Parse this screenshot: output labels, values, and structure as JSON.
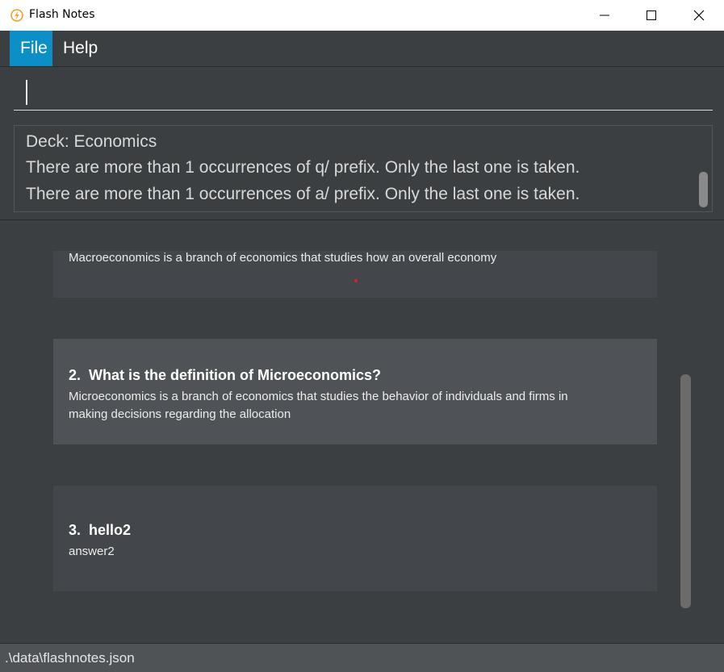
{
  "window": {
    "title": "Flash Notes"
  },
  "menu": {
    "file": "File",
    "help": "Help"
  },
  "command": {
    "value": ""
  },
  "result": {
    "lines": [
      "Deck: Economics",
      "There are more than 1 occurrences of q/ prefix. Only the last one is taken.",
      "There are more than 1 occurrences of a/ prefix. Only the last one is taken."
    ]
  },
  "cards": [
    {
      "answer": "Macroeconomics is a branch of economics that studies how an overall economy"
    },
    {
      "index": "2.",
      "question": "What is the definition of Microeconomics?",
      "answer_line1": "Microeconomics is a branch of economics that studies the behavior of individuals and firms in",
      "answer_line2": "making decisions regarding the allocation"
    },
    {
      "index": "3.",
      "question": "hello2",
      "answer": "answer2"
    }
  ],
  "status": {
    "path": ".\\data\\flashnotes.json"
  },
  "colors": {
    "accent": "#0b8fc7",
    "background": "#3c3f41",
    "card": "#43464a",
    "card_selected": "#4f5357"
  }
}
